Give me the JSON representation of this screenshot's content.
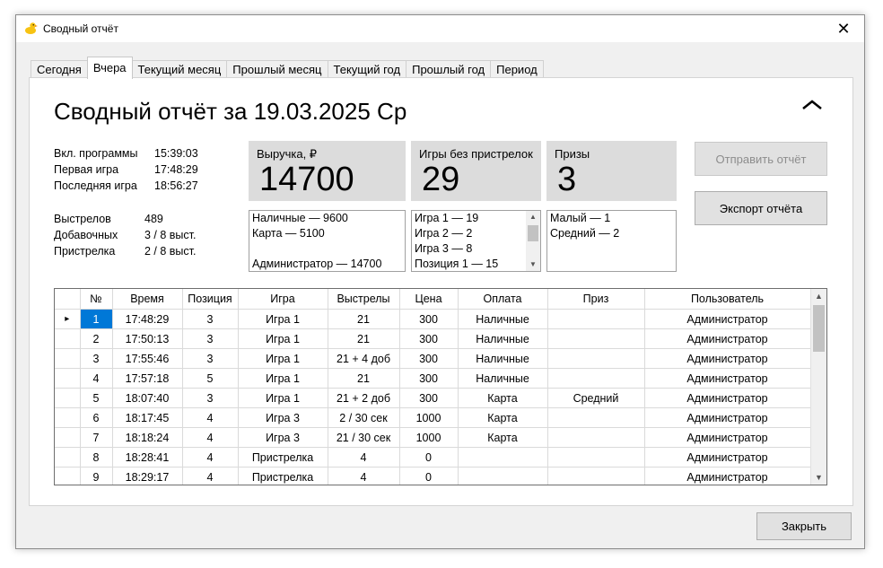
{
  "window": {
    "title": "Сводный отчёт",
    "close_glyph": "✕",
    "app_icon": "duck-icon"
  },
  "tabs": [
    {
      "label": "Сегодня",
      "active": false
    },
    {
      "label": "Вчера",
      "active": true
    },
    {
      "label": "Текущий месяц",
      "active": false
    },
    {
      "label": "Прошлый месяц",
      "active": false
    },
    {
      "label": "Текущий год",
      "active": false
    },
    {
      "label": "Прошлый год",
      "active": false
    },
    {
      "label": "Период",
      "active": false
    }
  ],
  "report": {
    "heading": "Сводный отчёт за 19.03.2025 Ср",
    "info_times": [
      {
        "label": "Вкл. программы",
        "value": "15:39:03"
      },
      {
        "label": "Первая игра",
        "value": "17:48:29"
      },
      {
        "label": "Последняя игра",
        "value": "18:56:27"
      }
    ],
    "info_shots": [
      {
        "label": "Выстрелов",
        "value": "489"
      },
      {
        "label": "Добавочных",
        "value": "3 / 8 выст."
      },
      {
        "label": "Пристрелка",
        "value": "2 / 8 выст."
      }
    ],
    "revenue": {
      "label": "Выручка, ₽",
      "value": "14700",
      "details": [
        "Наличные  —  9600",
        "Карта  —  5100",
        "",
        "Администратор  —  14700"
      ]
    },
    "games": {
      "label": "Игры без пристрелок",
      "value": "29",
      "details": [
        "Игра 1  —  19",
        "Игра 2  —  2",
        "Игра 3  —  8",
        "Позиция 1  —  15"
      ]
    },
    "prizes": {
      "label": "Призы",
      "value": "3",
      "details": [
        "Малый  —  1",
        "Средний  —  2"
      ]
    },
    "buttons": {
      "send": "Отправить отчёт",
      "export": "Экспорт отчёта",
      "close": "Закрыть"
    }
  },
  "table": {
    "columns": [
      "№",
      "Время",
      "Позиция",
      "Игра",
      "Выстрелы",
      "Цена",
      "Оплата",
      "Приз",
      "Пользователь"
    ],
    "rows": [
      [
        "1",
        "17:48:29",
        "3",
        "Игра 1",
        "21",
        "300",
        "Наличные",
        "",
        "Администратор"
      ],
      [
        "2",
        "17:50:13",
        "3",
        "Игра 1",
        "21",
        "300",
        "Наличные",
        "",
        "Администратор"
      ],
      [
        "3",
        "17:55:46",
        "3",
        "Игра 1",
        "21 + 4 доб",
        "300",
        "Наличные",
        "",
        "Администратор"
      ],
      [
        "4",
        "17:57:18",
        "5",
        "Игра 1",
        "21",
        "300",
        "Наличные",
        "",
        "Администратор"
      ],
      [
        "5",
        "18:07:40",
        "3",
        "Игра 1",
        "21 + 2 доб",
        "300",
        "Карта",
        "Средний",
        "Администратор"
      ],
      [
        "6",
        "18:17:45",
        "4",
        "Игра 3",
        "2 / 30 сек",
        "1000",
        "Карта",
        "",
        "Администратор"
      ],
      [
        "7",
        "18:18:24",
        "4",
        "Игра 3",
        "21 / 30 сек",
        "1000",
        "Карта",
        "",
        "Администратор"
      ],
      [
        "8",
        "18:28:41",
        "4",
        "Пристрелка",
        "4",
        "0",
        "",
        "",
        "Администратор"
      ],
      [
        "9",
        "18:29:17",
        "4",
        "Пристрелка",
        "4",
        "0",
        "",
        "",
        "Администратор"
      ]
    ],
    "selected_row": 0,
    "current_row_marker": "▸"
  },
  "colors": {
    "selection": "#0078d7",
    "stat_box": "#dcdcdc",
    "button": "#e1e1e1"
  }
}
